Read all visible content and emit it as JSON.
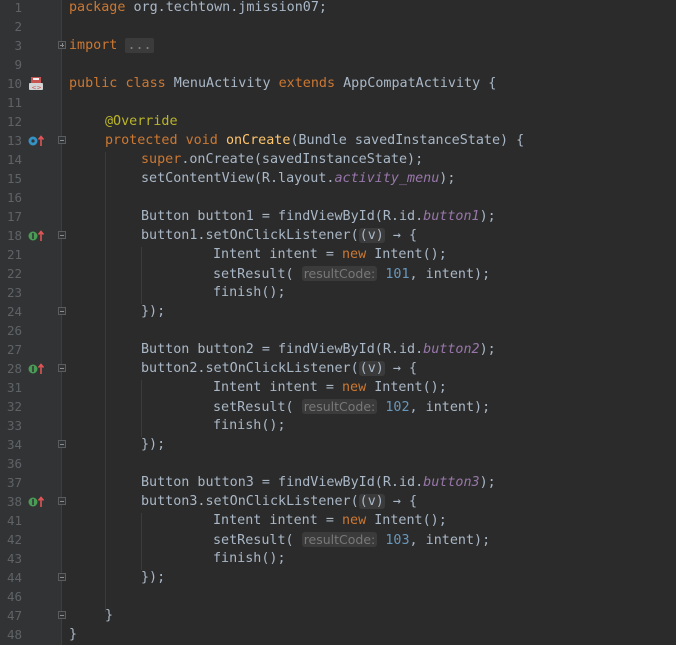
{
  "editor": {
    "lines": [
      {
        "n": "1",
        "t": "package org.techtown.jmission07;"
      },
      {
        "n": "2",
        "t": ""
      },
      {
        "n": "3",
        "t": "import ..."
      },
      {
        "n": "9",
        "t": ""
      },
      {
        "n": "10",
        "t": "public class MenuActivity extends AppCompatActivity {"
      },
      {
        "n": "11",
        "t": ""
      },
      {
        "n": "12",
        "t": "@Override"
      },
      {
        "n": "13",
        "t": "protected void onCreate(Bundle savedInstanceState) {"
      },
      {
        "n": "14",
        "t": "super.onCreate(savedInstanceState);"
      },
      {
        "n": "15",
        "t": "setContentView(R.layout.activity_menu);"
      },
      {
        "n": "16",
        "t": ""
      },
      {
        "n": "17",
        "t": "Button button1 = findViewById(R.id.button1);"
      },
      {
        "n": "18",
        "t": "button1.setOnClickListener((v) → {"
      },
      {
        "n": "21",
        "t": "Intent intent = new Intent();"
      },
      {
        "n": "22",
        "t": "setResult( resultCode: 101, intent);"
      },
      {
        "n": "23",
        "t": "finish();"
      },
      {
        "n": "24",
        "t": "});"
      },
      {
        "n": "26",
        "t": ""
      },
      {
        "n": "27",
        "t": "Button button2 = findViewById(R.id.button2);"
      },
      {
        "n": "28",
        "t": "button2.setOnClickListener((v) → {"
      },
      {
        "n": "31",
        "t": "Intent intent = new Intent();"
      },
      {
        "n": "32",
        "t": "setResult( resultCode: 102, intent);"
      },
      {
        "n": "33",
        "t": "finish();"
      },
      {
        "n": "34",
        "t": "});"
      },
      {
        "n": "36",
        "t": ""
      },
      {
        "n": "37",
        "t": "Button button3 = findViewById(R.id.button3);"
      },
      {
        "n": "38",
        "t": "button3.setOnClickListener((v) → {"
      },
      {
        "n": "41",
        "t": "Intent intent = new Intent();"
      },
      {
        "n": "42",
        "t": "setResult( resultCode: 103, intent);"
      },
      {
        "n": "43",
        "t": "finish();"
      },
      {
        "n": "44",
        "t": "});"
      },
      {
        "n": "46",
        "t": ""
      },
      {
        "n": "47",
        "t": "}"
      },
      {
        "n": "48",
        "t": "}"
      }
    ],
    "tokens": {
      "package_kw": "package",
      "package_name": " org.techtown.jmission07;",
      "import_kw": "import",
      "import_fold": "...",
      "public_kw": "public",
      "class_kw": "class",
      "class_name": " MenuActivity ",
      "extends_kw": "extends",
      "super_class": " AppCompatActivity {",
      "override": "@Override",
      "protected_kw": "protected",
      "void_kw": "void",
      "oncreate_fn": "onCreate",
      "oncreate_params": "(Bundle savedInstanceState) {",
      "super_kw": "super",
      "super_call": ".onCreate(savedInstanceState);",
      "setcontent": "setContentView(R.layout.",
      "layout_name": "activity_menu",
      "setcontent_end": ");",
      "btn_decl_1": "Button button1 = findViewById(R.id.",
      "btn_id_1": "button1",
      "btn_decl_2": "Button button2 = findViewById(R.id.",
      "btn_id_2": "button2",
      "btn_decl_3": "Button button3 = findViewById(R.id.",
      "btn_id_3": "button3",
      "btn_decl_end": ");",
      "listener_1": "button1.setOnClickListener(",
      "listener_2": "button2.setOnClickListener(",
      "listener_3": "button3.setOnClickListener(",
      "lambda_arg": "(v)",
      "lambda_arrow": " → {",
      "intent_decl": "Intent intent = ",
      "new_kw": "new",
      "intent_ctor": " Intent();",
      "setresult": "setResult( ",
      "result_hint": "resultCode:",
      "code_1": "101",
      "code_2": "102",
      "code_3": "103",
      "setresult_end": ", intent);",
      "finish": "finish();",
      "close_lambda": "});",
      "close_brace": "}"
    },
    "gutter_icons": {
      "line_10": "activity-layout-icon",
      "line_13": "override-method-icon",
      "line_18": "lambda-implement-icon",
      "line_28": "lambda-implement-icon",
      "line_38": "lambda-implement-icon"
    },
    "colors": {
      "background": "#2b2b2b",
      "gutter": "#313335",
      "keyword": "#cc7832",
      "function": "#ffc66d",
      "annotation": "#bbb529",
      "number": "#6897bb",
      "field_italic": "#9876aa",
      "default_text": "#a9b7c6",
      "line_number": "#606366"
    }
  }
}
